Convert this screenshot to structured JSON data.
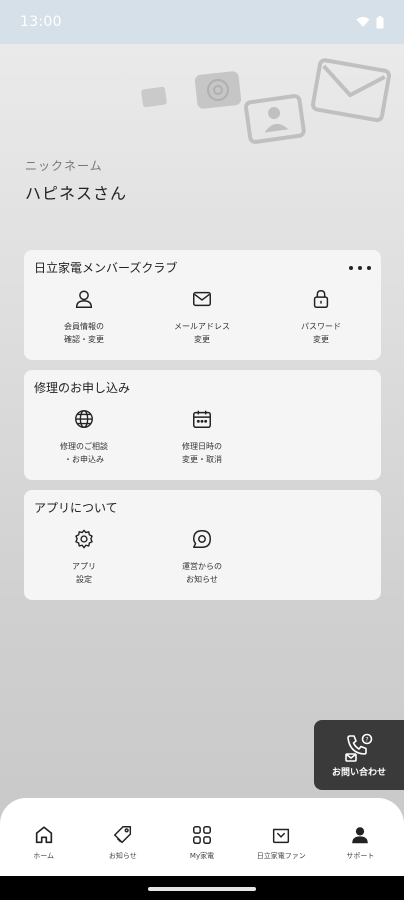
{
  "status_bar": {
    "time": "13:00"
  },
  "profile": {
    "nickname_label": "ニックネーム",
    "nickname": "ハピネスさん"
  },
  "cards": [
    {
      "title": "日立家電メンバーズクラブ",
      "items": [
        {
          "label": "会員情報の\n確認・変更",
          "icon": "person-icon"
        },
        {
          "label": "メールアドレス\n変更",
          "icon": "mail-icon"
        },
        {
          "label": "パスワード\n変更",
          "icon": "lock-icon"
        }
      ]
    },
    {
      "title": "修理のお申し込み",
      "items": [
        {
          "label": "修理のご相談\n・お申込み",
          "icon": "globe-icon"
        },
        {
          "label": "修理日時の\n変更・取消",
          "icon": "calendar-icon"
        }
      ]
    },
    {
      "title": "アプリについて",
      "items": [
        {
          "label": "アプリ\n設定",
          "icon": "gear-icon"
        },
        {
          "label": "運営からの\nお知らせ",
          "icon": "chat-icon"
        }
      ]
    }
  ],
  "contact_button": {
    "label": "お問い合わせ",
    "icon": "phone-mail-icon"
  },
  "bottom_nav": [
    {
      "label": "ホーム",
      "icon": "home-icon"
    },
    {
      "label": "お知らせ",
      "icon": "tag-icon"
    },
    {
      "label": "My家電",
      "icon": "grid-icon"
    },
    {
      "label": "日立家電ファン",
      "icon": "shop-icon"
    },
    {
      "label": "サポート",
      "icon": "user-icon"
    }
  ],
  "colors": {
    "status_bar": "#d5e0e9",
    "card": "#f5f5f5",
    "contact_button": "#3a3a3a",
    "nav": "#ffffff"
  }
}
